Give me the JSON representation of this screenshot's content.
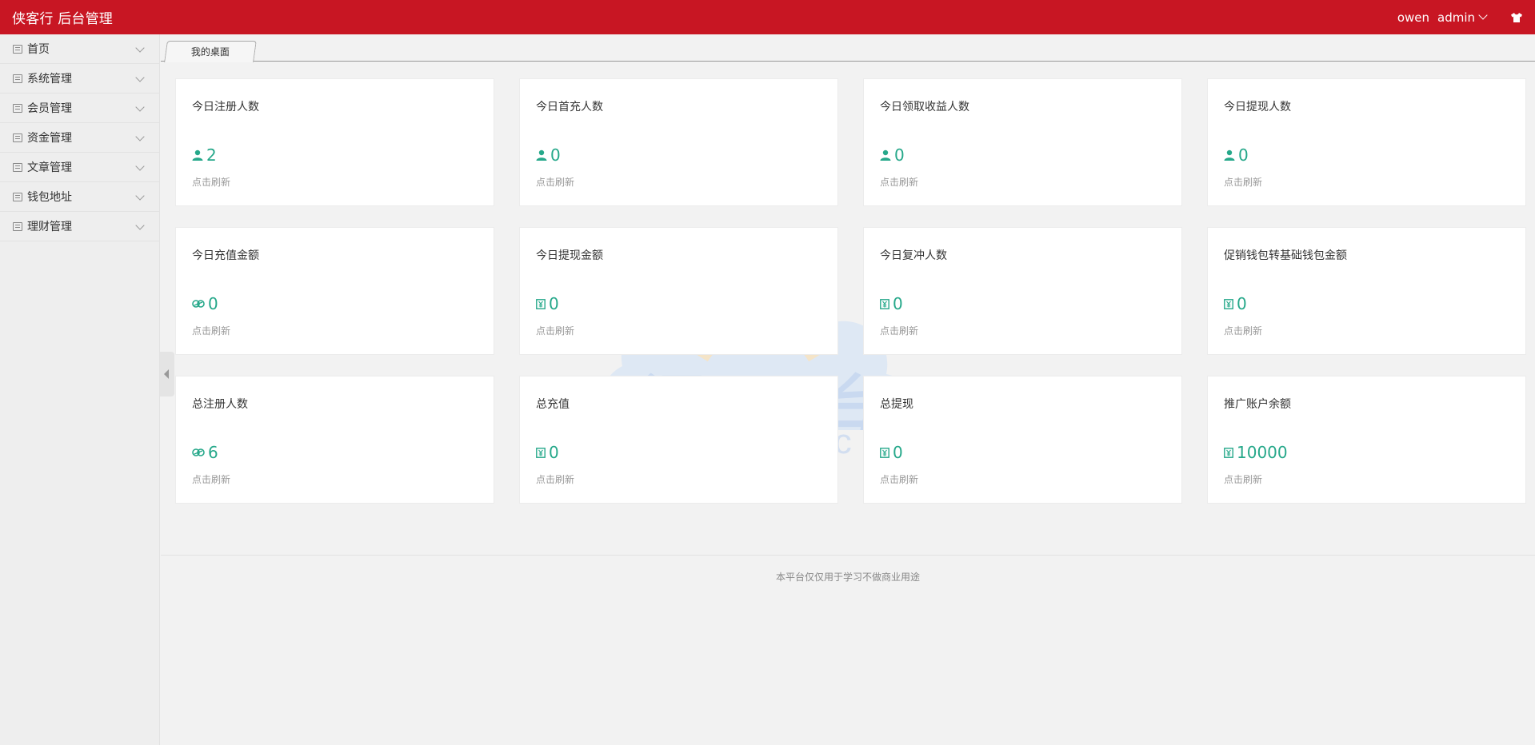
{
  "header": {
    "brand": "侠客行 后台管理",
    "user": "owen",
    "role": "admin",
    "bg_color": "#c81623"
  },
  "sidebar": {
    "items": [
      {
        "label": "首页"
      },
      {
        "label": "系统管理"
      },
      {
        "label": "会员管理"
      },
      {
        "label": "资金管理"
      },
      {
        "label": "文章管理"
      },
      {
        "label": "钱包地址"
      },
      {
        "label": "理财管理"
      }
    ]
  },
  "tabs": [
    {
      "label": "我的桌面"
    }
  ],
  "cards": [
    {
      "title": "今日注册人数",
      "value": "2",
      "icon": "user-icon",
      "hint": "点击刷新"
    },
    {
      "title": "今日首充人数",
      "value": "0",
      "icon": "user-icon",
      "hint": "点击刷新"
    },
    {
      "title": "今日领取收益人数",
      "value": "0",
      "icon": "user-icon",
      "hint": "点击刷新"
    },
    {
      "title": "今日提现人数",
      "value": "0",
      "icon": "user-icon",
      "hint": "点击刷新"
    },
    {
      "title": "今日充值金额",
      "value": "0",
      "icon": "dollar-icon",
      "hint": "点击刷新"
    },
    {
      "title": "今日提现金额",
      "value": "0",
      "icon": "yen-box-icon",
      "hint": "点击刷新"
    },
    {
      "title": "今日复冲人数",
      "value": "0",
      "icon": "yen-box-icon",
      "hint": "点击刷新"
    },
    {
      "title": "促销钱包转基础钱包金额",
      "value": "0",
      "icon": "yen-box-icon",
      "hint": "点击刷新"
    },
    {
      "title": "总注册人数",
      "value": "6",
      "icon": "dollar-icon",
      "hint": "点击刷新"
    },
    {
      "title": "总充值",
      "value": "0",
      "icon": "yen-box-icon",
      "hint": "点击刷新"
    },
    {
      "title": "总提现",
      "value": "0",
      "icon": "yen-box-icon",
      "hint": "点击刷新"
    },
    {
      "title": "推广账户余额",
      "value": "10000",
      "icon": "yen-box-icon",
      "hint": "点击刷新"
    }
  ],
  "accent_color": "#26a88a",
  "footer": {
    "text": "本平台仅仅用于学习不做商业用途"
  },
  "watermark": {
    "text": "源码平台",
    "url": "www.ympt.cc"
  }
}
